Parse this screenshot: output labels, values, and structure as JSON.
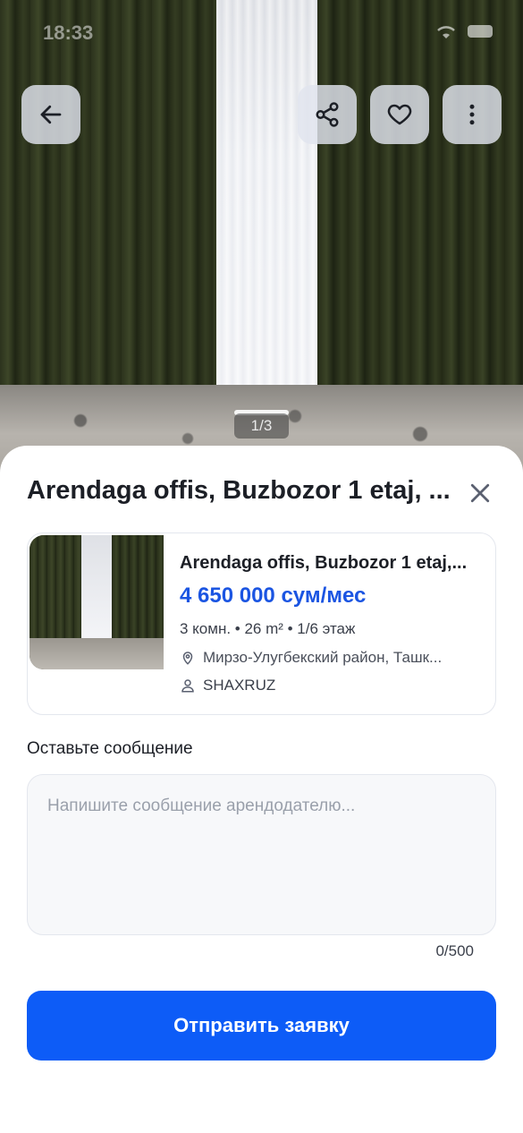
{
  "status_bar": {
    "time": "18:33"
  },
  "header_buttons": {
    "back_icon": "arrow-left-icon",
    "share_icon": "share-icon",
    "favorite_icon": "heart-icon",
    "more_icon": "more-vertical-icon"
  },
  "gallery": {
    "counter": "1/3"
  },
  "sheet": {
    "title": "Arendaga offis, Buzbozor 1 etaj, ...",
    "close_icon": "close-icon"
  },
  "listing": {
    "title": "Arendaga offis, Buzbozor 1 etaj,...",
    "price": "4 650 000 сум/мес",
    "specs": "3 комн. • 26 m² • 1/6 этаж",
    "location": "Мирзо-Улугбекский район, Ташк...",
    "owner": "SHAXRUZ"
  },
  "message": {
    "label": "Оставьте сообщение",
    "placeholder": "Напишите сообщение арендодателю...",
    "value": "",
    "counter": "0/500"
  },
  "submit": {
    "label": "Отправить заявку"
  },
  "colors": {
    "accent": "#0d5cf7",
    "price": "#1b55e2"
  }
}
